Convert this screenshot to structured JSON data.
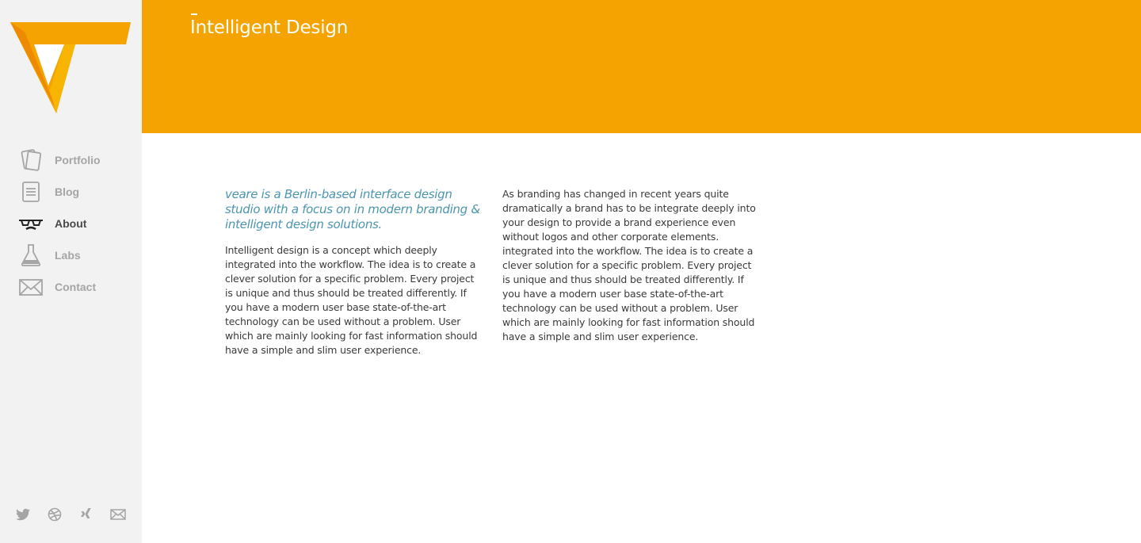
{
  "brand": {
    "logo_icon": "veare-v-logo-icon",
    "accent_color": "#f4a300",
    "lead_color": "#4c95b0"
  },
  "nav": {
    "items": [
      {
        "label": "Portfolio",
        "icon": "cards-icon",
        "active": false
      },
      {
        "label": "Blog",
        "icon": "document-icon",
        "active": false
      },
      {
        "label": "About",
        "icon": "glasses-mustache-icon",
        "active": true
      },
      {
        "label": "Labs",
        "icon": "flask-icon",
        "active": false
      },
      {
        "label": "Contact",
        "icon": "envelope-icon",
        "active": false
      }
    ]
  },
  "social": {
    "items": [
      "twitter-icon",
      "dribbble-icon",
      "xing-icon",
      "mail-icon"
    ]
  },
  "header": {
    "title": "Intelligent Design"
  },
  "content": {
    "lead": "veare is a Berlin-based interface design studio with a focus on in modern branding & intelligent design solutions.",
    "left_paragraph": "Intelligent design is a concept which deeply integrated into the workflow. The idea is to create a clever solution for a specific problem. Every project is unique and thus should be treated differently. If you have a modern user base state-of-the-art technology can be used without a problem. User which are mainly looking for fast information should have a simple and slim user experience.",
    "right_paragraph": "As branding has changed in recent years quite dramatically a brand has to be integrate deeply into your design to provide a brand experience even without logos and other corporate elements. integrated into the workflow. The idea is to create a clever solution for a specific problem. Every project is unique and thus should be treated differently. If you have a modern user base state-of-the-art technology can be used without a problem. User which are mainly looking for fast information should have a simple and slim user experience."
  }
}
